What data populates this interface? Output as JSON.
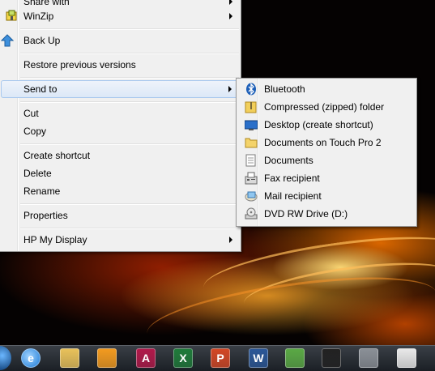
{
  "context_menu": {
    "items": [
      {
        "label": "Share with",
        "icon": "share-icon",
        "submenu": true
      },
      {
        "label": "WinZip",
        "icon": "winzip-icon",
        "submenu": true
      },
      {
        "label": "Back Up",
        "icon": "backup-arrow-icon",
        "submenu": false
      },
      {
        "label": "Restore previous versions",
        "icon": "",
        "submenu": false
      },
      {
        "label": "Send to",
        "icon": "",
        "submenu": true,
        "highlighted": true
      },
      {
        "label": "Cut",
        "icon": "",
        "submenu": false
      },
      {
        "label": "Copy",
        "icon": "",
        "submenu": false
      },
      {
        "label": "Create shortcut",
        "icon": "",
        "submenu": false
      },
      {
        "label": "Delete",
        "icon": "",
        "submenu": false
      },
      {
        "label": "Rename",
        "icon": "",
        "submenu": false
      },
      {
        "label": "Properties",
        "icon": "",
        "submenu": false
      },
      {
        "label": "HP My Display",
        "icon": "",
        "submenu": true
      }
    ]
  },
  "send_to_menu": {
    "items": [
      {
        "label": "Bluetooth",
        "icon": "bluetooth-icon"
      },
      {
        "label": "Compressed (zipped) folder",
        "icon": "zip-folder-icon"
      },
      {
        "label": "Desktop (create shortcut)",
        "icon": "desktop-icon"
      },
      {
        "label": "Documents on Touch Pro 2",
        "icon": "folder-icon"
      },
      {
        "label": "Documents",
        "icon": "documents-icon"
      },
      {
        "label": "Fax recipient",
        "icon": "fax-icon"
      },
      {
        "label": "Mail recipient",
        "icon": "mail-icon"
      },
      {
        "label": "DVD RW Drive (D:)",
        "icon": "dvd-drive-icon"
      }
    ]
  },
  "taskbar": {
    "apps": [
      {
        "name": "internet-explorer-icon",
        "letter": "e",
        "color": "#1e7bd6"
      },
      {
        "name": "file-explorer-icon",
        "letter": "",
        "color": "#e8c15a"
      },
      {
        "name": "media-player-icon",
        "letter": "",
        "color": "#f29a1f"
      },
      {
        "name": "access-icon",
        "letter": "A",
        "color": "#b0194a"
      },
      {
        "name": "excel-icon",
        "letter": "X",
        "color": "#1f7a3a"
      },
      {
        "name": "powerpoint-icon",
        "letter": "P",
        "color": "#d24726"
      },
      {
        "name": "word-icon",
        "letter": "W",
        "color": "#2b5797"
      },
      {
        "name": "app-icon-green",
        "letter": "",
        "color": "#5aa845"
      },
      {
        "name": "app-icon-diamond",
        "letter": "",
        "color": "#222222"
      },
      {
        "name": "app-icon-tool",
        "letter": "",
        "color": "#8a8f96"
      },
      {
        "name": "app-icon-card",
        "letter": "",
        "color": "#e8e8e8"
      }
    ]
  }
}
